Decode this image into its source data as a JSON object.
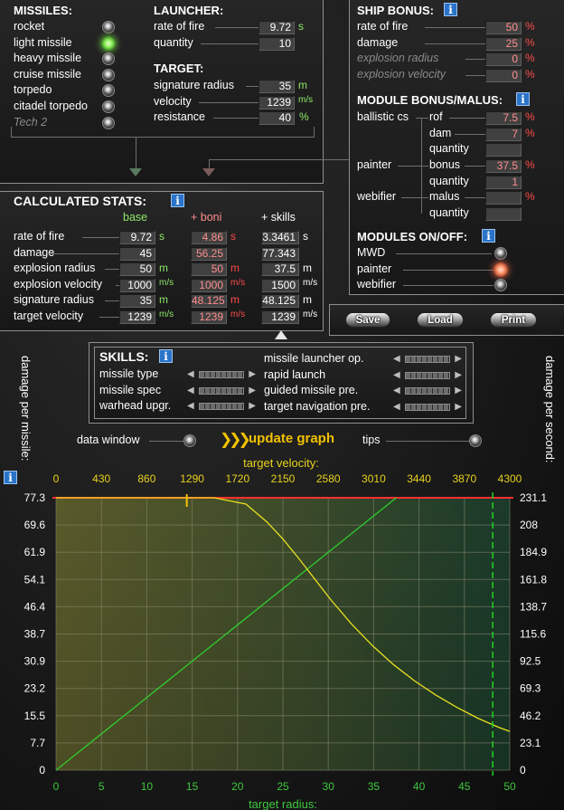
{
  "missiles": {
    "title": "MISSILES:",
    "items": [
      {
        "label": "rocket",
        "state": "off",
        "disabled": false
      },
      {
        "label": "light missile",
        "state": "on",
        "disabled": false
      },
      {
        "label": "heavy missile",
        "state": "off",
        "disabled": false
      },
      {
        "label": "cruise missile",
        "state": "off",
        "disabled": false
      },
      {
        "label": "torpedo",
        "state": "off",
        "disabled": false
      },
      {
        "label": "citadel torpedo",
        "state": "off",
        "disabled": false
      },
      {
        "label": "Tech 2",
        "state": "off",
        "disabled": true
      }
    ]
  },
  "launcher": {
    "title": "LAUNCHER:",
    "rate_of_fire_label": "rate of fire",
    "rate_of_fire": "9.72",
    "rate_of_fire_unit": "s",
    "quantity_label": "quantity",
    "quantity": "10"
  },
  "target": {
    "title": "TARGET:",
    "signature_radius_label": "signature radius",
    "signature_radius": "35",
    "signature_radius_unit": "m",
    "velocity_label": "velocity",
    "velocity": "1239",
    "velocity_unit": "m/s",
    "resistance_label": "resistance",
    "resistance": "40",
    "resistance_unit": "%"
  },
  "ship_bonus": {
    "title": "SHIP BONUS:",
    "items": [
      {
        "label": "rate of fire",
        "value": "50",
        "unit": "%",
        "disabled": false
      },
      {
        "label": "damage",
        "value": "25",
        "unit": "%",
        "disabled": false
      },
      {
        "label": "explosion radius",
        "value": "0",
        "unit": "%",
        "disabled": true
      },
      {
        "label": "explosion velocity",
        "value": "0",
        "unit": "%",
        "disabled": true
      }
    ]
  },
  "module_bonus": {
    "title": "MODULE BONUS/MALUS:",
    "ballistic_label": "ballistic cs",
    "ballistic_rof_label": "rof",
    "ballistic_rof": "7.5",
    "ballistic_rof_unit": "%",
    "ballistic_dam_label": "dam",
    "ballistic_dam": "7",
    "ballistic_dam_unit": "%",
    "ballistic_quantity_label": "quantity",
    "ballistic_quantity": "",
    "painter_label": "painter",
    "painter_bonus_label": "bonus",
    "painter_bonus": "37.5",
    "painter_bonus_unit": "%",
    "painter_quantity_label": "quantity",
    "painter_quantity": "1",
    "webifier_label": "webifier",
    "webifier_malus_label": "malus",
    "webifier_malus": "",
    "webifier_malus_unit": "%",
    "webifier_quantity_label": "quantity",
    "webifier_quantity": ""
  },
  "modules_onoff": {
    "title": "MODULES ON/OFF:",
    "items": [
      {
        "label": "MWD",
        "state": "off"
      },
      {
        "label": "painter",
        "state": "on"
      },
      {
        "label": "webifier",
        "state": "off"
      }
    ]
  },
  "buttons": {
    "save": "Save",
    "load": "Load",
    "print": "Print"
  },
  "calc": {
    "title": "CALCULATED STATS:",
    "col_base": "base",
    "col_boni": "+ boni",
    "col_skills": "+ skills",
    "rows": [
      {
        "label": "rate of fire",
        "base": "9.72",
        "base_unit": "s",
        "boni": "4.86",
        "boni_unit": "s",
        "skills": "3.3461",
        "skills_unit": "s"
      },
      {
        "label": "damage",
        "base": "45",
        "base_unit": "",
        "boni": "56.25",
        "boni_unit": "",
        "skills": "77.343",
        "skills_unit": ""
      },
      {
        "label": "explosion radius",
        "base": "50",
        "base_unit": "m",
        "boni": "50",
        "boni_unit": "m",
        "skills": "37.5",
        "skills_unit": "m"
      },
      {
        "label": "explosion velocity",
        "base": "1000",
        "base_unit": "m/s",
        "boni": "1000",
        "boni_unit": "m/s",
        "skills": "1500",
        "skills_unit": "m/s"
      },
      {
        "label": "signature radius",
        "base": "35",
        "base_unit": "m",
        "boni": "48.125",
        "boni_unit": "m",
        "skills": "48.125",
        "skills_unit": "m"
      },
      {
        "label": "target velocity",
        "base": "1239",
        "base_unit": "m/s",
        "boni": "1239",
        "boni_unit": "m/s",
        "skills": "1239",
        "skills_unit": "m/s"
      }
    ]
  },
  "skills": {
    "title": "SKILLS:",
    "left": [
      "missile type",
      "missile spec",
      "warhead upgr."
    ],
    "right": [
      "missile launcher op.",
      "rapid launch",
      "guided missile pre.",
      "target navigation pre."
    ]
  },
  "controls": {
    "data_window": "data window",
    "update_graph": "update graph",
    "tips": "tips"
  },
  "colors": {
    "dps_line": "#2fcc2f",
    "damage_line": "#e8e020",
    "max_line": "#ff3030",
    "marker": "#22cc22",
    "accent_yellow": "#f2c200"
  },
  "chart_data": {
    "type": "line",
    "y_left_label": "damage per missile:",
    "y_right_label": "damage per second:",
    "x_top_label": "target velocity:",
    "x_bottom_label": "target radius:",
    "x_bottom_ticks": [
      "0",
      "5",
      "10",
      "15",
      "20",
      "25",
      "30",
      "35",
      "40",
      "45",
      "50"
    ],
    "x_top_ticks": [
      "0",
      "430",
      "860",
      "1290",
      "1720",
      "2150",
      "2580",
      "3010",
      "3440",
      "3870",
      "4300"
    ],
    "y_left_ticks": [
      "77.3",
      "69.6",
      "61.9",
      "54.1",
      "46.4",
      "38.7",
      "30.9",
      "23.2",
      "15.5",
      "7.7",
      "0"
    ],
    "y_right_ticks": [
      "231.1",
      "208",
      "184.9",
      "161.8",
      "138.7",
      "115.6",
      "92.5",
      "69.3",
      "46.2",
      "23.1",
      "0"
    ],
    "xlim": [
      0,
      50
    ],
    "x_top_lim": [
      0,
      4300
    ],
    "ylim": [
      0,
      77.3
    ],
    "y_right_lim": [
      0,
      231.1
    ],
    "grid": true,
    "series": [
      {
        "axis": "left-vs-radius",
        "color": "#2fcc2f",
        "x": [
          0,
          37.5
        ],
        "y": [
          0,
          77.3
        ]
      },
      {
        "axis": "left-vs-velocity",
        "color": "#e8e020",
        "x": [
          0,
          1500,
          1800,
          2000,
          2150,
          2300,
          2450,
          2600,
          2800,
          3000,
          3200,
          3400,
          3600,
          3800,
          4000,
          4200,
          4300
        ],
        "y": [
          77.3,
          77.3,
          75.5,
          70.4,
          65.6,
          60.1,
          54.3,
          48.5,
          41.5,
          35.3,
          29.9,
          25.3,
          21.3,
          17.8,
          14.7,
          12.1,
          11.0
        ]
      }
    ],
    "max_line": 77.3,
    "marker_velocity": 1239,
    "marker_radius": 48.125
  }
}
